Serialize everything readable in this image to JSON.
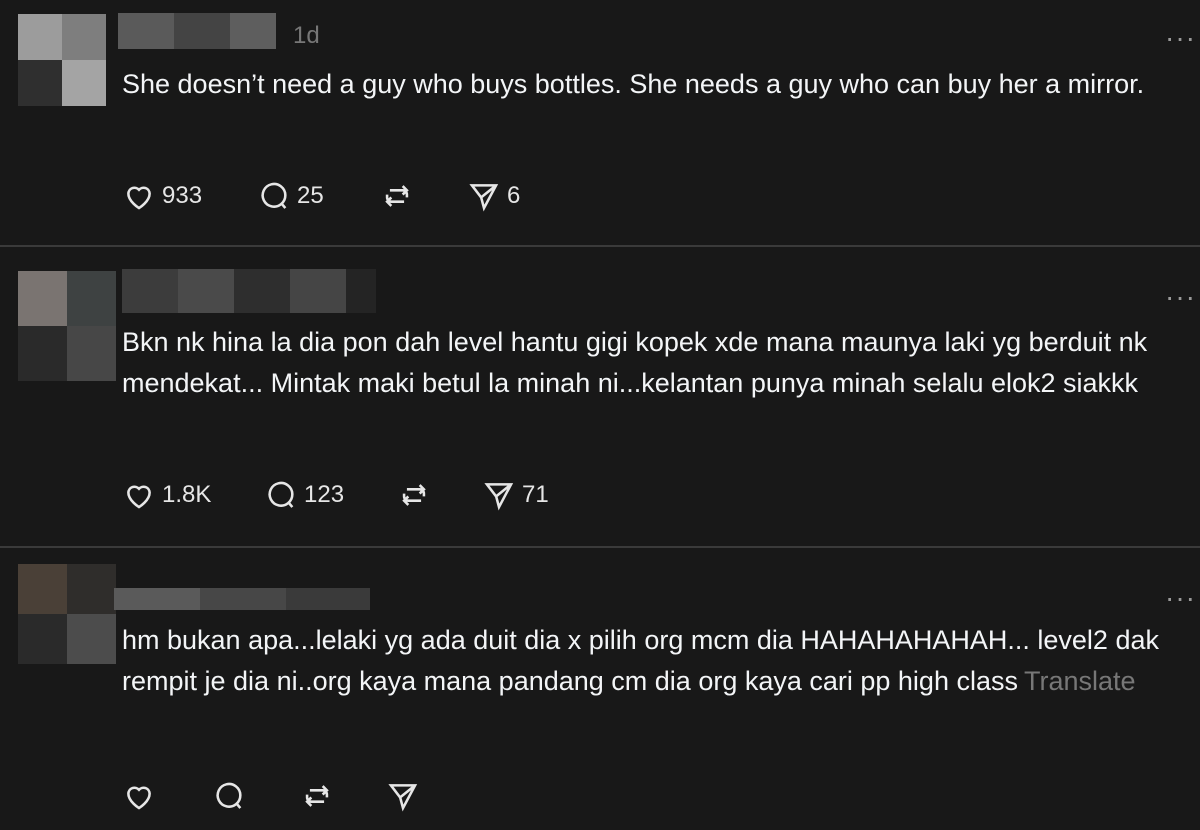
{
  "posts": [
    {
      "time": "1d",
      "text": "She doesn’t need a guy who buys bottles. She needs a guy who can buy her a mirror.",
      "likes": "933",
      "replies": "25",
      "reposts": "",
      "shares": "6",
      "translate": ""
    },
    {
      "time": "",
      "text": "Bkn nk hina la dia pon dah level hantu gigi kopek xde mana maunya laki yg berduit nk mendekat... Mintak maki betul la minah ni...kelantan punya minah selalu elok2 siakkk",
      "likes": "1.8K",
      "replies": "123",
      "reposts": "",
      "shares": "71",
      "translate": ""
    },
    {
      "time": "",
      "text": "hm bukan apa...lelaki yg ada duit dia x pilih org mcm dia HAHAHAHAHAH... level2 dak rempit je dia ni..org kaya mana pandang cm dia org kaya cari pp high class",
      "likes": "",
      "replies": "",
      "reposts": "",
      "shares": "",
      "translate": "Translate"
    }
  ],
  "icons": {
    "more": "more-options-icon",
    "like": "heart-icon",
    "reply": "comment-bubble-icon",
    "repost": "repost-icon",
    "share": "send-icon"
  },
  "colors": {
    "background": "#181818",
    "text": "#f3f5f7",
    "muted": "#777777",
    "divider": "#3a3a3a"
  }
}
